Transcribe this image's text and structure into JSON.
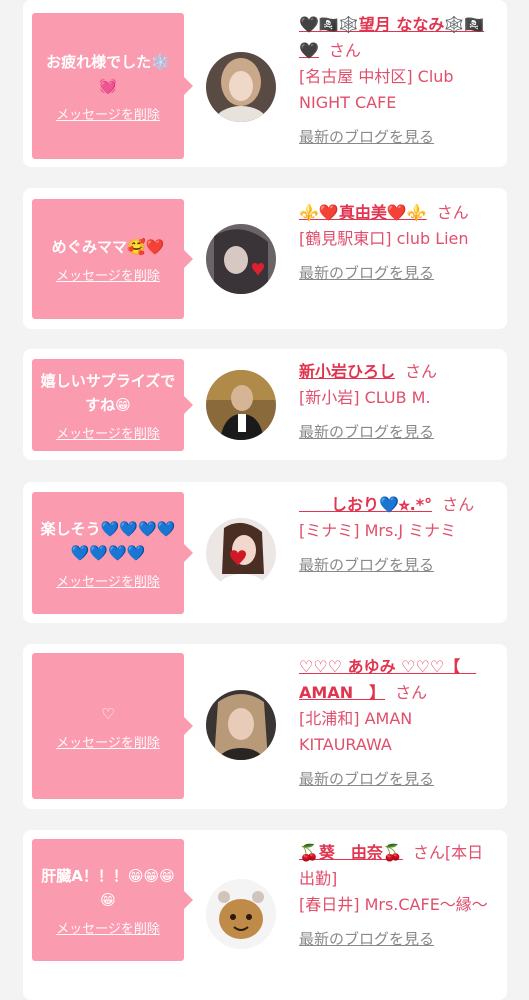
{
  "items": [
    {
      "message": "お疲れ様でした❄️💓",
      "delete_label": "メッセージを削除",
      "name": "🖤🏴‍☠️🕸️望月 ななみ🕸️🏴‍☠️🖤",
      "san": "さん",
      "shop": "[名古屋 中村区] Club NIGHT CAFE",
      "blog_label": "最新のブログを見る"
    },
    {
      "message": "めぐみママ🥰❤️",
      "delete_label": "メッセージを削除",
      "name": "⚜️❤️真由美❤️⚜️",
      "san": "さん",
      "shop": "[鶴見駅東口] club Lien",
      "blog_label": "最新のブログを見る"
    },
    {
      "message": "嬉しいサプライズですね😁",
      "delete_label": "メッセージを削除",
      "name": "新小岩ひろし",
      "san": "さん",
      "shop": "[新小岩] CLUB M.",
      "blog_label": "最新のブログを見る"
    },
    {
      "message": "楽しそう💙💙💙💙💙💙💙💙",
      "delete_label": "メッセージを削除",
      "name": "　　しおり💙⭐︎.*°",
      "san": "さん",
      "shop": "[ミナミ] Mrs.J ミナミ",
      "blog_label": "最新のブログを見る"
    },
    {
      "message": "♡",
      "delete_label": "メッセージを削除",
      "name": "♡♡♡ あゆみ ♡♡♡【　AMAN　】",
      "san": "さん",
      "shop": "[北浦和] AMAN KITAURAWA",
      "blog_label": "最新のブログを見る"
    },
    {
      "message": "肝臓A！！！😁😁😁😁",
      "delete_label": "メッセージを削除",
      "name": "🍒葵　由奈🍒",
      "san": "さん[本日出勤]",
      "shop": "[春日井] Mrs.CAFE〜縁〜",
      "blog_label": "最新のブログを見る"
    }
  ]
}
